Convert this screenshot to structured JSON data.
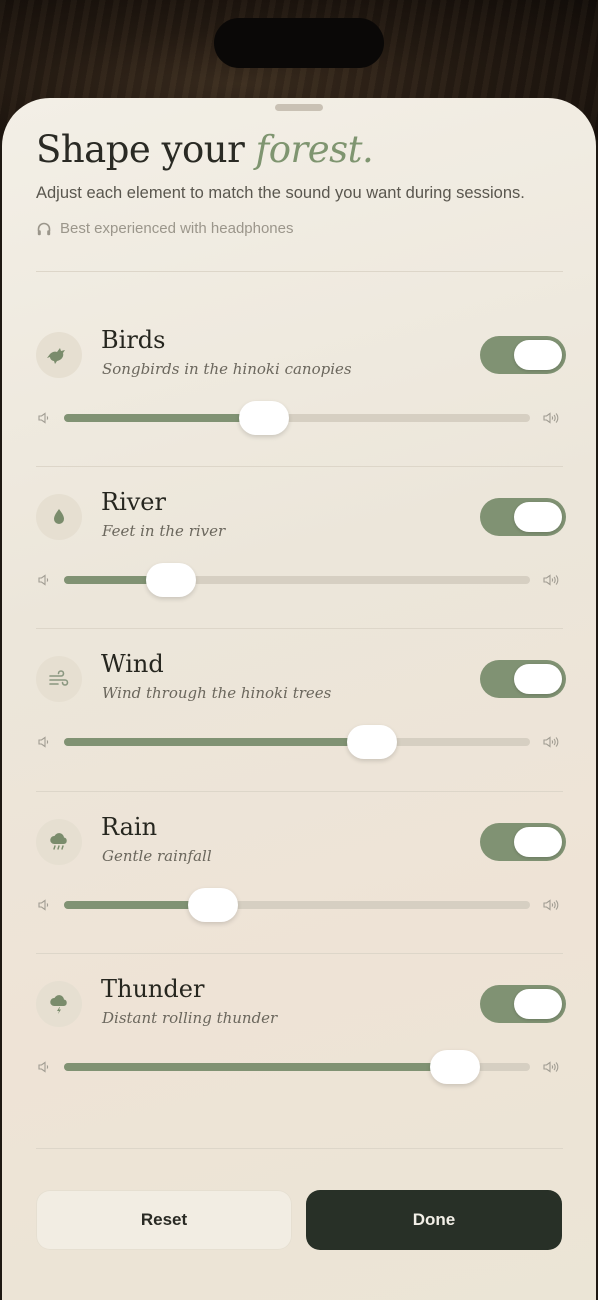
{
  "header": {
    "title_plain": "Shape your",
    "title_accent": "forest.",
    "subtitle": "Adjust each element to match the sound you want during sessions.",
    "hint": "Best experienced with headphones",
    "hint_icon": "headphones-icon"
  },
  "colors": {
    "accent": "#809273",
    "sheet": "#f0ebe1",
    "done_bg": "#283027"
  },
  "sounds": [
    {
      "name": "Birds",
      "description": "Songbirds in the hinoki canopies",
      "icon": "bird-icon",
      "enabled": true,
      "volume": 0.43
    },
    {
      "name": "River",
      "description": "Feet in the river",
      "icon": "water-drop-icon",
      "enabled": true,
      "volume": 0.23
    },
    {
      "name": "Wind",
      "description": "Wind through the hinoki trees",
      "icon": "wind-icon",
      "enabled": true,
      "volume": 0.66
    },
    {
      "name": "Rain",
      "description": "Gentle rainfall",
      "icon": "rain-cloud-icon",
      "enabled": true,
      "volume": 0.32
    },
    {
      "name": "Thunder",
      "description": "Distant rolling thunder",
      "icon": "thunder-cloud-icon",
      "enabled": true,
      "volume": 0.84
    }
  ],
  "actions": {
    "reset_label": "Reset",
    "done_label": "Done"
  }
}
